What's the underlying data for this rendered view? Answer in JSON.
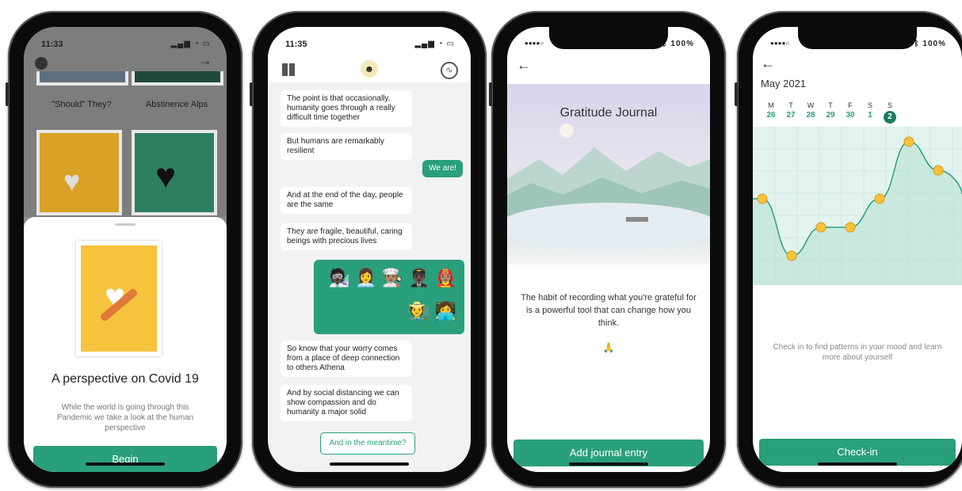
{
  "phone1": {
    "status_time": "11:33",
    "tile_labels": [
      "\"Should\" They?",
      "Abstinence Alps"
    ],
    "title": "A perspective on Covid 19",
    "description": "While the world is going through this Pandemic we take a look at the human perspective",
    "button": "Begin",
    "icons": [
      "gear-icon",
      "arrow-right-icon"
    ]
  },
  "phone2": {
    "status_time": "11:35",
    "messages": [
      {
        "text": "The point is that occasionally, humanity goes through a really difficult time together",
        "from": "bot"
      },
      {
        "text": "But humans are remarkably resilient",
        "from": "bot"
      },
      {
        "text": "We are!",
        "from": "user"
      },
      {
        "text": "And at the end of the day, people are the same",
        "from": "bot"
      },
      {
        "text": "They are fragile, beautiful, caring beings with precious lives",
        "from": "bot"
      },
      {
        "text": "So know that your worry comes from a place of deep connection to others Athena",
        "from": "bot"
      },
      {
        "text": "And by social distancing we can show compassion and do humanity a major solid",
        "from": "bot"
      }
    ],
    "emoji_row1": "🧑🏿‍🔬 👩‍💼 👨🏽‍🍳 👨🏿‍✈️ 👩🏽‍🚒",
    "emoji_row2": "🧑‍🌾 👩‍💻",
    "reply_option": "And in the meantime?"
  },
  "phone3": {
    "status_carrier": "●●●●○",
    "status_battery": "100%",
    "title": "Gratitude Journal",
    "description": "The habit of recording what you're grateful for is a powerful tool that can change how you think.",
    "emoji": "🙏",
    "button": "Add journal entry"
  },
  "phone4": {
    "status_carrier": "●●●●○",
    "status_battery": "100%",
    "month": "May 2021",
    "days": [
      {
        "letter": "M",
        "num": "26"
      },
      {
        "letter": "T",
        "num": "27"
      },
      {
        "letter": "W",
        "num": "28"
      },
      {
        "letter": "T",
        "num": "29"
      },
      {
        "letter": "F",
        "num": "30"
      },
      {
        "letter": "S",
        "num": "1"
      },
      {
        "letter": "S",
        "num": "2"
      }
    ],
    "mood_values": [
      0.55,
      0.15,
      0.35,
      0.35,
      0.55,
      0.95,
      0.75
    ],
    "message": "Check in to find patterns in your mood and learn more about yourself",
    "button": "Check-in",
    "accent": "#2a9f7c"
  }
}
